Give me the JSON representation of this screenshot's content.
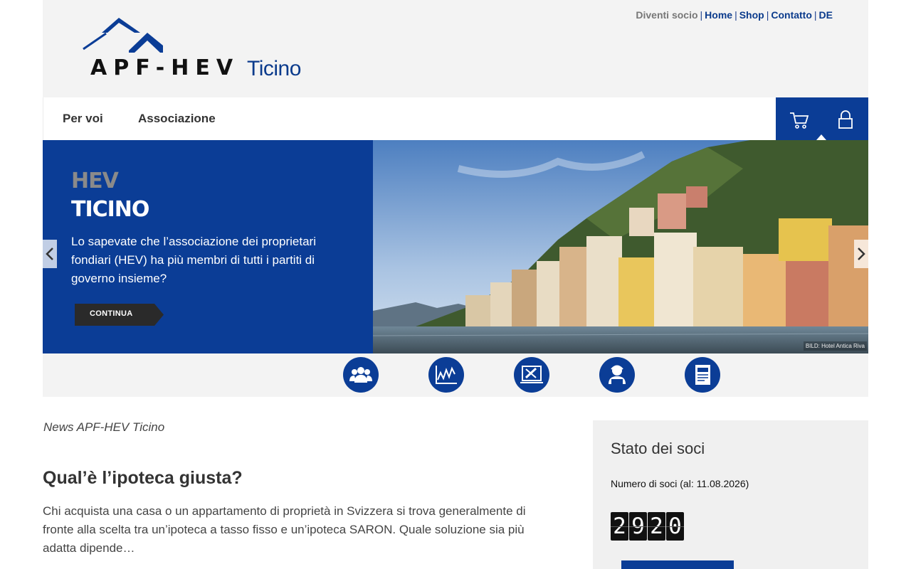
{
  "topbar": {
    "join": "Diventi socio",
    "links": [
      "Home",
      "Shop",
      "Contatto",
      "DE"
    ]
  },
  "logo": {
    "name": "APF-HEV",
    "region": "Ticino"
  },
  "nav": {
    "items": [
      "Per voi",
      "Associazione"
    ],
    "icons": [
      "cart-icon",
      "lock-icon"
    ]
  },
  "hero": {
    "kicker": "HEV",
    "title": "TICINO",
    "text": "Lo sapevate che l’associazione dei proprietari fondiari (HEV) ha più membri di tutti i partiti di governo insieme?",
    "button": "CONTINUA",
    "credit": "BILD: Hotel Antica Riva",
    "accent": "#0b3d96"
  },
  "service_icons": [
    "members-icon",
    "chart-icon",
    "tools-icon",
    "advisor-icon",
    "news-icon"
  ],
  "content": {
    "section_label": "News APF-HEV Ticino",
    "article_title": "Qual’è l’ipoteca giusta?",
    "article_text": "Chi acquista una casa o un appartamento di proprietà in Svizzera si trova generalmente di fronte alla scelta tra un’ipoteca a tasso fisso e un’ipoteca SARON. Quale soluzione sia più adatta dipende…"
  },
  "sidebar": {
    "title": "Stato dei soci",
    "subtitle": "Numero di soci (al: 11.08.2026)",
    "digits": [
      "2",
      "9",
      "2",
      "0"
    ]
  }
}
